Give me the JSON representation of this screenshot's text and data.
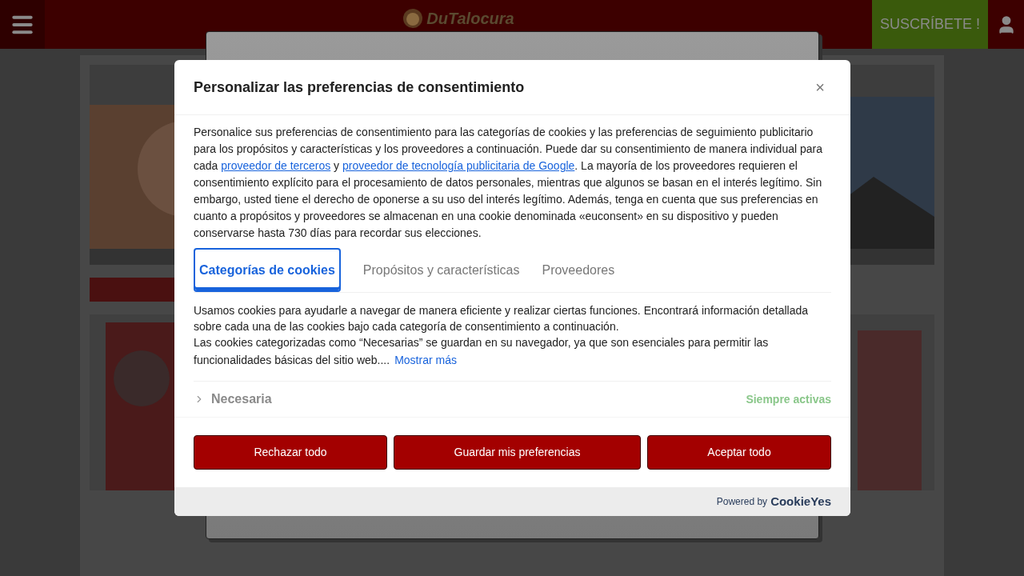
{
  "header": {
    "logo": "DuTalocura",
    "subscribe": "SUSCRÍBETE !"
  },
  "dialog": {
    "title": "Personalizar las preferencias de consentimiento",
    "close": "×",
    "intro": [
      {
        "kind": "text",
        "text": "Personalice sus preferencias de consentimiento para las categorías de cookies y las preferencias de seguimiento publicitario para los propósitos y características y los proveedores a continuación. Puede dar su consentimiento de manera individual para cada "
      },
      {
        "kind": "link",
        "text": "proveedor de terceros"
      },
      {
        "kind": "text",
        "text": " y "
      },
      {
        "kind": "link",
        "text": "proveedor de tecnología publicitaria de Google"
      },
      {
        "kind": "text",
        "text": ". La mayoría de los proveedores requieren el consentimiento explícito para el procesamiento de datos personales, mientras que algunos se basan en el interés legítimo. Sin embargo, usted tiene el derecho de oponerse a su uso del interés legítimo. Además, tenga en cuenta que sus preferencias en cuanto a propósitos y proveedores se almacenan en una cookie denominada «euconsent» en su dispositivo y pueden conservarse hasta 730 días para recordar sus elecciones."
      }
    ],
    "tabs": [
      {
        "label": "Categorías de cookies",
        "selected": true
      },
      {
        "label": "Propósitos y características",
        "selected": false
      },
      {
        "label": "Proveedores",
        "selected": false
      }
    ],
    "description": [
      "Usamos cookies para ayudarle a navegar de manera eficiente y realizar ciertas funciones. Encontrará información detallada sobre cada una de las cookies bajo cada categoría de consentimiento a continuación.",
      "Las cookies categorizadas como “Necesarias” se guardan en su navegador, ya que son esenciales para permitir las funcionalidades básicas del sitio web...."
    ],
    "show_more": "Mostrar más",
    "categories": [
      {
        "name": "Necesaria",
        "status": "Siempre activas",
        "expanded": false
      }
    ],
    "buttons": [
      "Rechazar todo",
      "Guardar mis preferencias",
      "Aceptar todo"
    ],
    "powered_by": "Powered by",
    "brand": "CookieYes"
  }
}
